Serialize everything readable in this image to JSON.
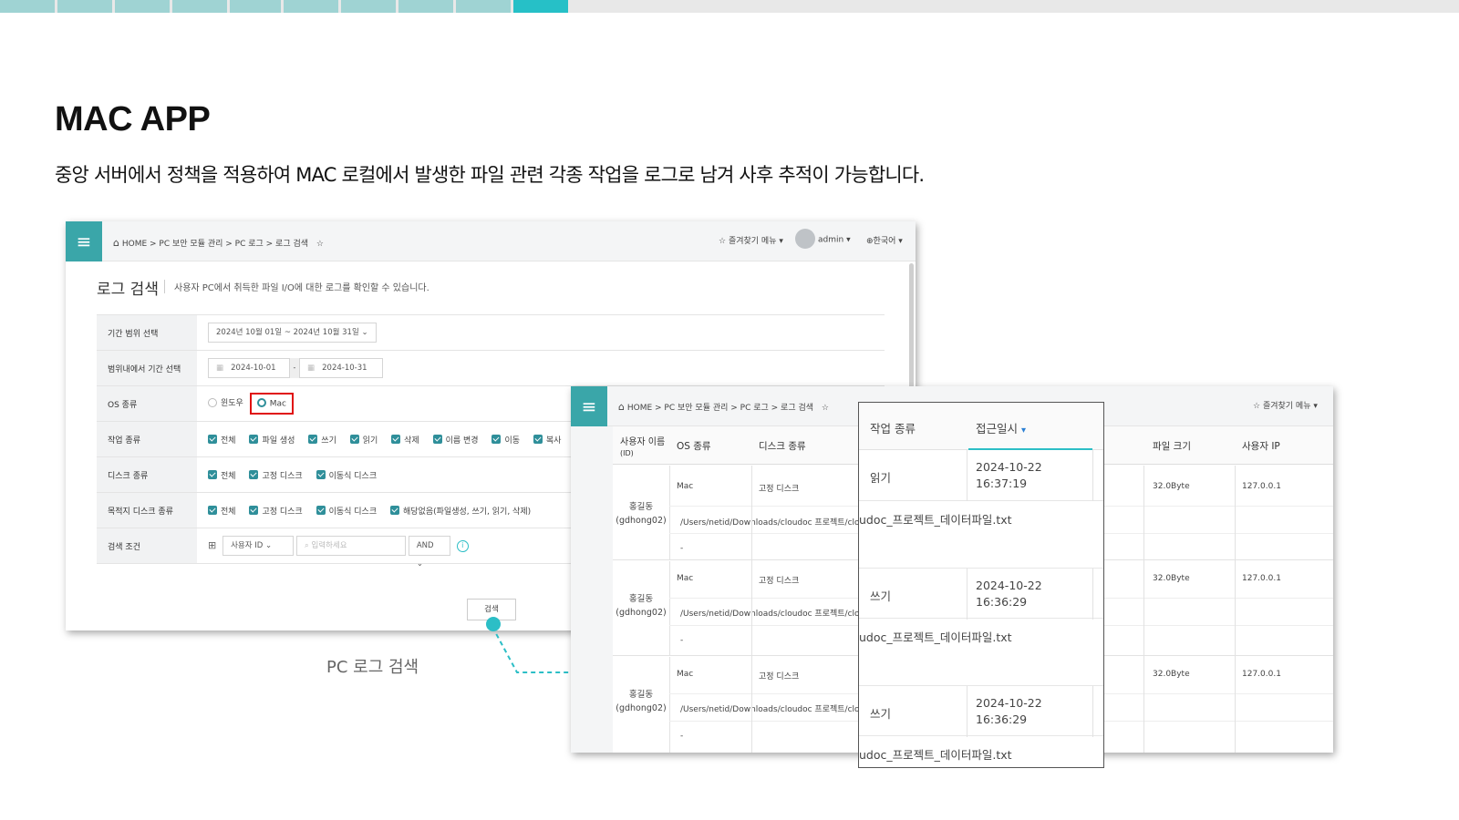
{
  "progress": {
    "segments": 10,
    "active_index": 9
  },
  "title": "MAC APP",
  "subtitle": "중앙 서버에서 정책을 적용하여 MAC 로컬에서 발생한 파일 관련 각종 작업을 로그로 남겨 사후 추적이 가능합니다.",
  "caption": "PC 로그 검색",
  "shot1": {
    "breadcrumb": "HOME > PC 보안 모듈 관리 > PC 로그 > 로그 검색",
    "favorites": "즐겨찾기 메뉴",
    "user": "admin",
    "language": "한국어",
    "page_title": "로그 검색",
    "page_desc": "사용자 PC에서 취득한 파일 I/O에 대한 로그를 확인할 수 있습니다.",
    "form": {
      "period_label": "기간 범위 선택",
      "period_value": "2024년 10월 01일 ~ 2024년 10월 31일",
      "range_label": "범위내에서 기간 선택",
      "start_date": "2024-10-01",
      "end_date": "2024-10-31",
      "os_label": "OS 종류",
      "os_windows": "윈도우",
      "os_mac": "Mac",
      "task_label": "작업 종류",
      "tasks": [
        "전체",
        "파일 생성",
        "쓰기",
        "읽기",
        "삭제",
        "이름 변경",
        "이동",
        "복사"
      ],
      "disk_label": "디스크 종류",
      "disks": [
        "전체",
        "고정 디스크",
        "이동식 디스크"
      ],
      "target_label": "목적지 디스크 종류",
      "targets": [
        "전체",
        "고정 디스크",
        "이동식 디스크",
        "해당없음(파일생성, 쓰기, 읽기, 삭제)"
      ],
      "cond_label": "검색 조건",
      "cond_field": "사용자 ID",
      "cond_placeholder": "입력하세요",
      "cond_op": "AND",
      "search_button": "검색"
    }
  },
  "shot2": {
    "breadcrumb": "HOME > PC 보안 모듈 관리 > PC 로그 > 로그 검색",
    "favorites": "즐겨찾기 메뉴",
    "headers": {
      "user": "사용자 이름",
      "user_id": "(ID)",
      "os": "OS 종류",
      "disk": "디스크 종류",
      "size": "파일 크기",
      "ip": "사용자 IP"
    },
    "rows": [
      {
        "name": "홍길동",
        "id": "(gdhong02)",
        "os": "Mac",
        "disk": "고정 디스크",
        "size": "32.0Byte",
        "ip": "127.0.0.1",
        "path": "/Users/netid/Downloads/cloudoc 프로젝트/clou",
        "dash": "-"
      },
      {
        "name": "홍길동",
        "id": "(gdhong02)",
        "os": "Mac",
        "disk": "고정 디스크",
        "size": "32.0Byte",
        "ip": "127.0.0.1",
        "path": "/Users/netid/Downloads/cloudoc 프로젝트/clou",
        "dash": "-"
      },
      {
        "name": "홍길동",
        "id": "(gdhong02)",
        "os": "Mac",
        "disk": "고정 디스크",
        "size": "32.0Byte",
        "ip": "127.0.0.1",
        "path": "/Users/netid/Downloads/cloudoc 프로젝트/clou",
        "dash": "-"
      }
    ]
  },
  "popup": {
    "col_task": "작업 종류",
    "col_time": "접근일시",
    "rows": [
      {
        "task": "읽기",
        "date": "2024-10-22",
        "time": "16:37:19",
        "file": "udoc_프로젝트_데이터파일.txt"
      },
      {
        "task": "쓰기",
        "date": "2024-10-22",
        "time": "16:36:29",
        "file": "udoc_프로젝트_데이터파일.txt"
      },
      {
        "task": "쓰기",
        "date": "2024-10-22",
        "time": "16:36:29",
        "file": "udoc_프로젝트_데이터파일.txt"
      }
    ]
  },
  "colors": {
    "accent": "#2cbec6",
    "hamburger": "#3aa6a9",
    "highlight": "#e01010"
  }
}
